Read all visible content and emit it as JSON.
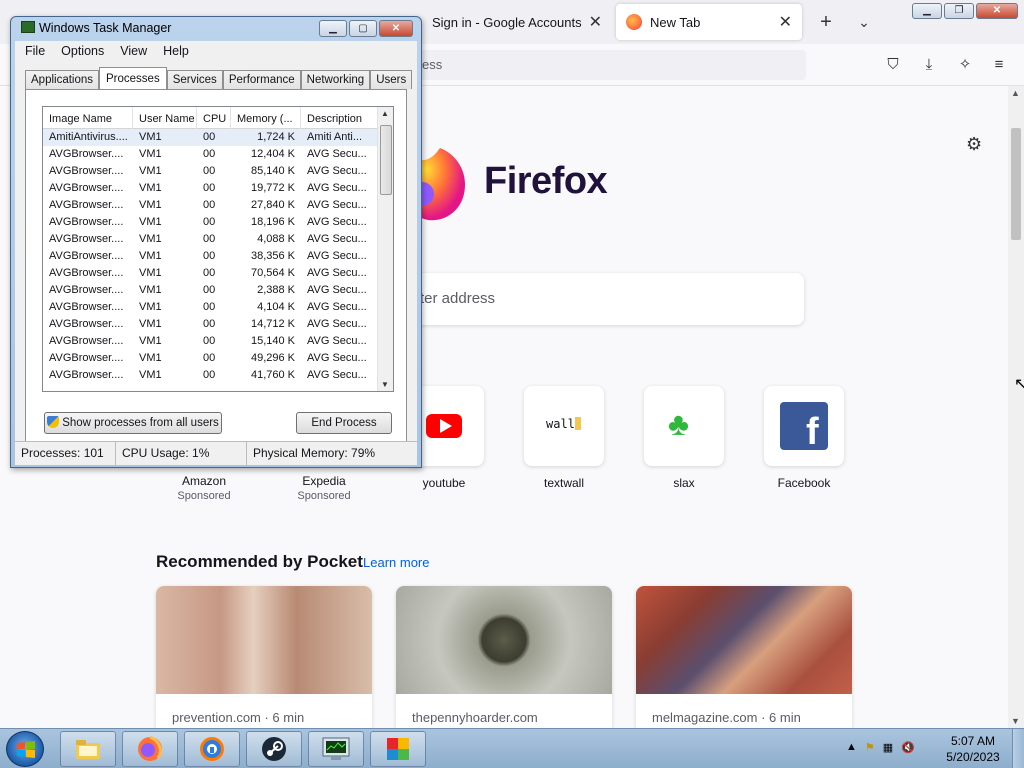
{
  "firefox": {
    "tabs": [
      {
        "title": "Sign in - Google Accounts",
        "active": false
      },
      {
        "title": "New Tab",
        "active": true
      }
    ],
    "url_placeholder": "ess",
    "search_placeholder": "ter address",
    "brand": "Firefox",
    "top_sites": [
      {
        "label": "Amazon",
        "sponsored": "Sponsored"
      },
      {
        "label": "Expedia",
        "sponsored": "Sponsored"
      },
      {
        "label": "youtube"
      },
      {
        "label": "textwall",
        "tile_text": "wall"
      },
      {
        "label": "slax"
      },
      {
        "label": "Facebook"
      }
    ],
    "pocket": {
      "heading": "Recommended by Pocket",
      "learn_more": "Learn more",
      "cards": [
        {
          "source": "prevention.com · 6 min"
        },
        {
          "source": "thepennyhoarder.com"
        },
        {
          "source": "melmagazine.com · 6 min"
        }
      ]
    }
  },
  "task_manager": {
    "title": "Windows Task Manager",
    "menu": [
      "File",
      "Options",
      "View",
      "Help"
    ],
    "tabs": [
      "Applications",
      "Processes",
      "Services",
      "Performance",
      "Networking",
      "Users"
    ],
    "selected_tab": "Processes",
    "columns": [
      "Image Name",
      "User Name",
      "CPU",
      "Memory (...",
      "Description"
    ],
    "rows": [
      [
        "AmitiAntivirus....",
        "VM1",
        "00",
        "1,724 K",
        "Amiti Anti..."
      ],
      [
        "AVGBrowser....",
        "VM1",
        "00",
        "12,404 K",
        "AVG Secu..."
      ],
      [
        "AVGBrowser....",
        "VM1",
        "00",
        "85,140 K",
        "AVG Secu..."
      ],
      [
        "AVGBrowser....",
        "VM1",
        "00",
        "19,772 K",
        "AVG Secu..."
      ],
      [
        "AVGBrowser....",
        "VM1",
        "00",
        "27,840 K",
        "AVG Secu..."
      ],
      [
        "AVGBrowser....",
        "VM1",
        "00",
        "18,196 K",
        "AVG Secu..."
      ],
      [
        "AVGBrowser....",
        "VM1",
        "00",
        "4,088 K",
        "AVG Secu..."
      ],
      [
        "AVGBrowser....",
        "VM1",
        "00",
        "38,356 K",
        "AVG Secu..."
      ],
      [
        "AVGBrowser....",
        "VM1",
        "00",
        "70,564 K",
        "AVG Secu..."
      ],
      [
        "AVGBrowser....",
        "VM1",
        "00",
        "2,388 K",
        "AVG Secu..."
      ],
      [
        "AVGBrowser....",
        "VM1",
        "00",
        "4,104 K",
        "AVG Secu..."
      ],
      [
        "AVGBrowser....",
        "VM1",
        "00",
        "14,712 K",
        "AVG Secu..."
      ],
      [
        "AVGBrowser....",
        "VM1",
        "00",
        "15,140 K",
        "AVG Secu..."
      ],
      [
        "AVGBrowser....",
        "VM1",
        "00",
        "49,296 K",
        "AVG Secu..."
      ],
      [
        "AVGBrowser....",
        "VM1",
        "00",
        "41,760 K",
        "AVG Secu..."
      ]
    ],
    "show_all_button": "Show processes from all users",
    "end_process_button": "End Process",
    "status": {
      "processes": "Processes: 101",
      "cpu": "CPU Usage: 1%",
      "memory": "Physical Memory: 79%"
    }
  },
  "taskbar": {
    "pinned": [
      "explorer-icon",
      "firefox-icon",
      "avast-secure-browser-icon",
      "steam-icon",
      "task-manager-icon",
      "avg-icon"
    ],
    "clock_time": "5:07 AM",
    "clock_date": "5/20/2023"
  }
}
